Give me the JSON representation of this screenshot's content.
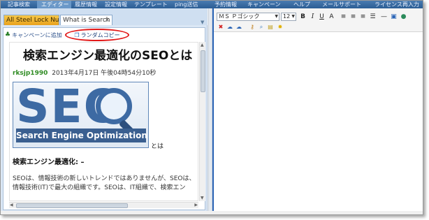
{
  "menubar": {
    "items": [
      {
        "label": "記事検索",
        "active": false
      },
      {
        "label": "エディター",
        "active": true
      },
      {
        "label": "履歴情報",
        "active": false
      },
      {
        "label": "設定情報",
        "active": false
      },
      {
        "label": "テンプレート",
        "active": false
      },
      {
        "label": "ping送信",
        "active": false
      },
      {
        "label": "予約情報",
        "active": false
      },
      {
        "label": "キャンペーン",
        "active": false
      },
      {
        "label": "ヘルプ",
        "active": false
      },
      {
        "label": "メールサポート",
        "active": false
      },
      {
        "label": "ライセンス再入力",
        "active": false
      }
    ]
  },
  "tabs": [
    {
      "label": "All Steel Lock Nut",
      "active": false
    },
    {
      "label": "What is Search E",
      "active": true
    }
  ],
  "toolbar": {
    "campaign_label": "キャンペーンに追加",
    "random_copy_label": "ランダムコピー"
  },
  "article": {
    "title": "検索エンジン最適化のSEOとは",
    "author": "rksjp1990",
    "date": "2013年4月17日 午後04時54分10秒",
    "image_text": "SEO",
    "image_caption": "Search Engine Optimization",
    "after_image": "とは",
    "subheading": "検索エンジン最適化: –",
    "body_line1": "SEOは、情報技術の新しいトレンドではありませんが、SEOは、",
    "body_line2": "情報技術(IT)で最大の組織です。SEOは、IT組織で、検索エン"
  },
  "editor": {
    "font_name": "ＭＳ Ｐゴシック",
    "font_size": "12"
  },
  "colors": {
    "menubar": "#2b5d94",
    "tab_active_orange": "#e9a21e",
    "highlight_red": "#e21818",
    "author_green": "#2e8b22",
    "seo_blue": "#3d6aa3"
  }
}
